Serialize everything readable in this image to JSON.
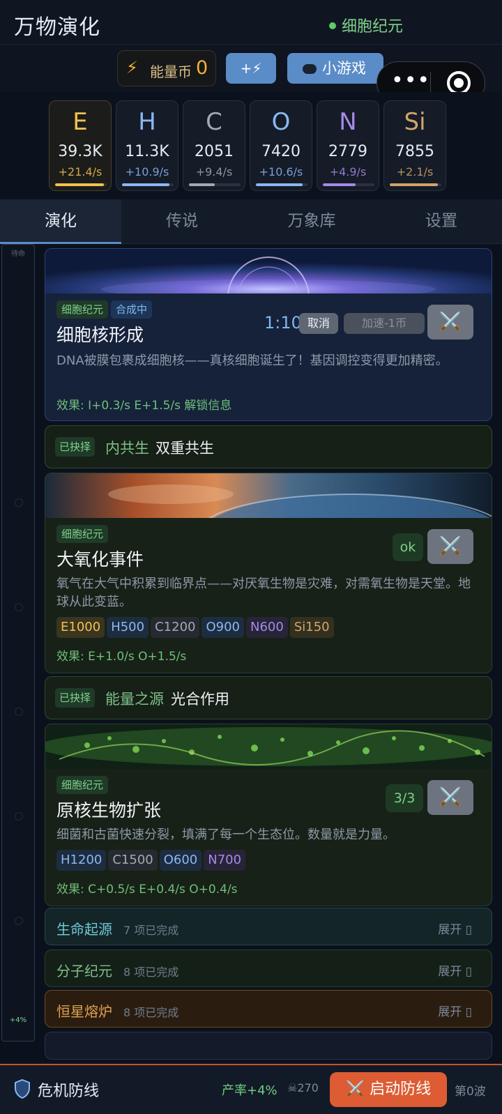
{
  "header": {
    "title": "万物演化",
    "era": "细胞纪元",
    "era_dot_color": "#5ecb6a"
  },
  "toolbar": {
    "coin_icon": "lightning-icon",
    "coin_label": "能量币",
    "coin_value": "0",
    "plus_label": "+⚡",
    "minigame_label": "小游戏",
    "minigame_icon": "gamepad-icon"
  },
  "capsule": {
    "more_icon": "more-dots-icon",
    "close_icon": "target-icon"
  },
  "resources": [
    {
      "symbol": "E",
      "value": "39.3K",
      "rate": "+21.4/s",
      "color": "#f2c14e",
      "fill": 0.95
    },
    {
      "symbol": "H",
      "value": "11.3K",
      "rate": "+10.9/s",
      "color": "#8ab8f2",
      "fill": 0.92
    },
    {
      "symbol": "C",
      "value": "2051",
      "rate": "+9.4/s",
      "color": "#a2aab6",
      "fill": 0.5
    },
    {
      "symbol": "O",
      "value": "7420",
      "rate": "+10.6/s",
      "color": "#8ab8f2",
      "fill": 0.9
    },
    {
      "symbol": "N",
      "value": "2779",
      "rate": "+4.9/s",
      "color": "#a58ae6",
      "fill": 0.64
    },
    {
      "symbol": "Si",
      "value": "7855",
      "rate": "+2.1/s",
      "color": "#d1a66a",
      "fill": 0.93
    }
  ],
  "tabs": [
    {
      "label": "演化",
      "active": true
    },
    {
      "label": "传说"
    },
    {
      "label": "万象库"
    },
    {
      "label": "设置"
    }
  ],
  "rail": {
    "top_label": "待命",
    "bottom_label": "+4%"
  },
  "cards": {
    "nucleus": {
      "tag_era": "细胞纪元",
      "tag_status": "合成中",
      "title": "细胞核形成",
      "timer": "1:10",
      "cancel_label": "取消",
      "speedup_label": "加速-1币",
      "desc": "DNA被膜包裹成细胞核——真核细胞诞生了！基因调控变得更加精密。",
      "effect": "效果: I+0.3/s  E+1.5/s  解锁信息"
    },
    "choice1": {
      "tag": "已抉择",
      "category": "内共生",
      "name": "双重共生"
    },
    "oxidation": {
      "tag_era": "细胞纪元",
      "title": "大氧化事件",
      "status": "ok",
      "desc": "氧气在大气中积累到临界点——对厌氧生物是灾难，对需氧生物是天堂。地球从此变蓝。",
      "costs": [
        {
          "label": "E1000",
          "bg": "#3a3520",
          "fg": "#f2c14e"
        },
        {
          "label": "H500",
          "bg": "#1d2d40",
          "fg": "#8ab8f2"
        },
        {
          "label": "C1200",
          "bg": "#242a30",
          "fg": "#a2aab6"
        },
        {
          "label": "O900",
          "bg": "#1d2d40",
          "fg": "#8ab8f2"
        },
        {
          "label": "N600",
          "bg": "#272438",
          "fg": "#a58ae6"
        },
        {
          "label": "Si150",
          "bg": "#33301f",
          "fg": "#d1a66a"
        }
      ],
      "effect": "效果: E+1.0/s  O+1.5/s"
    },
    "choice2": {
      "tag": "已抉择",
      "category": "能量之源",
      "name": "光合作用"
    },
    "prokaryote": {
      "tag_era": "细胞纪元",
      "title": "原核生物扩张",
      "status": "3/3",
      "desc": "细菌和古菌快速分裂，填满了每一个生态位。数量就是力量。",
      "costs": [
        {
          "label": "H1200",
          "bg": "#1d2d40",
          "fg": "#8ab8f2"
        },
        {
          "label": "C1500",
          "bg": "#242a30",
          "fg": "#a2aab6"
        },
        {
          "label": "O600",
          "bg": "#1d2d40",
          "fg": "#8ab8f2"
        },
        {
          "label": "N700",
          "bg": "#272438",
          "fg": "#a58ae6"
        }
      ],
      "effect": "效果: C+0.5/s  E+0.4/s  O+0.4/s"
    }
  },
  "sections": [
    {
      "name": "生命起源",
      "count": "7 项已完成",
      "expand": "展开 ▯",
      "color": "#6fc8d8",
      "bg": "#132527",
      "border": "#24464a"
    },
    {
      "name": "分子纪元",
      "count": "8 项已完成",
      "expand": "展开 ▯",
      "color": "#7fc08a",
      "bg": "#142017",
      "border": "#27402b"
    },
    {
      "name": "恒星熔炉",
      "count": "8 项已完成",
      "expand": "展开 ▯",
      "color": "#e0a050",
      "bg": "#2a1d10",
      "border": "#6a4a22"
    }
  ],
  "footer": {
    "title": "危机防线",
    "rate": "产率+4%",
    "skull": "☠270",
    "button": "⚔️ 启动防线",
    "wave": "第0波"
  }
}
